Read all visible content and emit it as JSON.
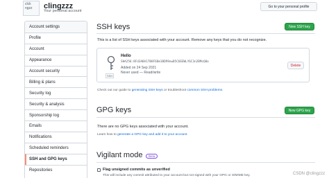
{
  "header": {
    "avatar_alt": "clck ngzz",
    "username": "clingzzz",
    "subtitle": "Your personal account",
    "profile_button": "Go to your personal profile"
  },
  "sidebar": {
    "items": [
      {
        "label": "Account settings"
      },
      {
        "label": "Profile"
      },
      {
        "label": "Account"
      },
      {
        "label": "Appearance"
      },
      {
        "label": "Account security"
      },
      {
        "label": "Billing & plans"
      },
      {
        "label": "Security log"
      },
      {
        "label": "Security & analysis"
      },
      {
        "label": "Sponsorship log"
      },
      {
        "label": "Emails"
      },
      {
        "label": "Notifications"
      },
      {
        "label": "Scheduled reminders"
      },
      {
        "label": "SSH and GPG keys"
      },
      {
        "label": "Repositories"
      }
    ]
  },
  "ssh": {
    "title": "SSH keys",
    "new_button": "New SSH key",
    "description": "This is a list of SSH keys associated with your account. Remove any keys that you do not recognize.",
    "key": {
      "type_tag": "SSH",
      "title": "Hello",
      "fingerprint": "SHA256:8Fd3ABA17B8F6Dm1BDP8nwB5C6EEWLY6C3n2BMcQ0o",
      "added": "Added on 24 Sep 2021",
      "used": "Never used — Read/write",
      "delete_button": "Delete"
    },
    "guide_prefix": "Check out our guide to ",
    "guide_link1": "generating SSH keys",
    "guide_middle": " or troubleshoot ",
    "guide_link2": "common SSH problems",
    "guide_suffix": "."
  },
  "gpg": {
    "title": "GPG keys",
    "new_button": "New GPG key",
    "empty_text": "There are no GPG keys associated with your account.",
    "learn_prefix": "Learn how to ",
    "learn_link": "generate a GPG key and add it to your account",
    "learn_suffix": "."
  },
  "vigilant": {
    "title": "Vigilant mode",
    "badge": "Beta",
    "checkbox_label": "Flag unsigned commits as unverified",
    "note": "This will include any commit attributed to your account but not signed with your GPG or S/MIME key."
  },
  "watermark": "CSDN @clingzzz"
}
